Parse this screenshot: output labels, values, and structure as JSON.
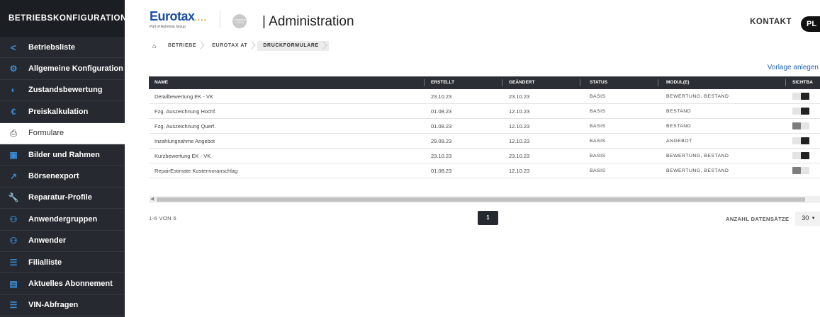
{
  "sidebar": {
    "title": "BETRIEBSKONFIGURATION",
    "items": [
      {
        "label": "Betriebsliste",
        "icon": "chevron-left-icon",
        "glyph": "<"
      },
      {
        "label": "Allgemeine Konfiguration",
        "icon": "gear-icon",
        "glyph": "⚙"
      },
      {
        "label": "Zustandsbewertung",
        "icon": "condition-icon",
        "glyph": "◐"
      },
      {
        "label": "Preiskalkulation",
        "icon": "euro-icon",
        "glyph": "€"
      },
      {
        "label": "Formulare",
        "icon": "printer-icon",
        "glyph": "⎙",
        "active": true
      },
      {
        "label": "Bilder und Rahmen",
        "icon": "image-icon",
        "glyph": "▣"
      },
      {
        "label": "Börsenexport",
        "icon": "export-icon",
        "glyph": "↗"
      },
      {
        "label": "Reparatur-Profile",
        "icon": "wrench-icon",
        "glyph": "🔧"
      },
      {
        "label": "Anwendergruppen",
        "icon": "users-icon",
        "glyph": "⚇"
      },
      {
        "label": "Anwender",
        "icon": "user-icon",
        "glyph": "⚇"
      },
      {
        "label": "Filialliste",
        "icon": "list-icon",
        "glyph": "☰"
      },
      {
        "label": "Aktuelles Abonnement",
        "icon": "document-icon",
        "glyph": "▤"
      },
      {
        "label": "VIN-Abfragen",
        "icon": "list-icon",
        "glyph": "☰"
      }
    ]
  },
  "header": {
    "logo_text": "Eurotax",
    "logo_dots": "....",
    "logo_sub": "Part of Autorista Group",
    "company_logo_text": "Company LOGO",
    "title": "| Administration",
    "contact": "KONTAKT",
    "avatar": "PL"
  },
  "breadcrumb": [
    "BETRIEBE",
    "EUROTAX AT",
    "DRUCKFORMULARE"
  ],
  "actions": {
    "create_template": "Vorlage anlegen"
  },
  "table": {
    "columns": [
      "NAME",
      "ERSTELLT",
      "GEÄNDERT",
      "STATUS",
      "MODUL(E)",
      "SICHTBA"
    ],
    "rows": [
      {
        "name": "Detailbewertung EK - VK",
        "created": "23.10.23",
        "changed": "23.10.23",
        "status": "BASIS",
        "modules": "BEWERTUNG, BESTAND",
        "visible": true
      },
      {
        "name": "Fzg. Auszeichnung Hochf.",
        "created": "01.08.23",
        "changed": "12.10.23",
        "status": "BASIS",
        "modules": "BESTAND",
        "visible": true
      },
      {
        "name": "Fzg. Auszeichnung Querf.",
        "created": "01.08.23",
        "changed": "12.10.23",
        "status": "BASIS",
        "modules": "BESTAND",
        "visible": false
      },
      {
        "name": "Inzahlungnahme Angebot",
        "created": "29.09.23",
        "changed": "12.10.23",
        "status": "BASIS",
        "modules": "ANGEBOT",
        "visible": true
      },
      {
        "name": "Kurzbewertung EK - VK",
        "created": "23.10.23",
        "changed": "23.10.23",
        "status": "BASIS",
        "modules": "BEWERTUNG, BESTAND",
        "visible": true
      },
      {
        "name": "RepairEstimate Kostenvoranschlag",
        "created": "01.08.23",
        "changed": "12.10.23",
        "status": "BASIS",
        "modules": "BEWERTUNG, BESTAND",
        "visible": false
      }
    ]
  },
  "footer": {
    "count": "1-6 VON 6",
    "page": "1",
    "page_size_label": "ANZAHL DATENSÄTZE",
    "page_size": "30"
  }
}
